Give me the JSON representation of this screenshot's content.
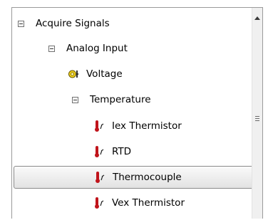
{
  "tree": {
    "items": [
      {
        "label": "Acquire Signals",
        "icon": "collapse-icon",
        "expanded": true
      },
      {
        "label": "Analog Input",
        "icon": "collapse-icon",
        "expanded": true
      },
      {
        "label": "Voltage",
        "icon": "voltage-sensor-icon"
      },
      {
        "label": "Temperature",
        "icon": "collapse-icon",
        "expanded": true
      },
      {
        "label": "Iex Thermistor",
        "icon": "thermometer-icon"
      },
      {
        "label": "RTD",
        "icon": "thermometer-icon"
      },
      {
        "label": "Thermocouple",
        "icon": "thermometer-icon",
        "selected": true
      },
      {
        "label": "Vex Thermistor",
        "icon": "thermometer-icon"
      }
    ]
  },
  "colors": {
    "thermometer_red": "#c0141b",
    "voltage_yellow": "#f2d21c",
    "selection_border": "#8a8a8a"
  }
}
